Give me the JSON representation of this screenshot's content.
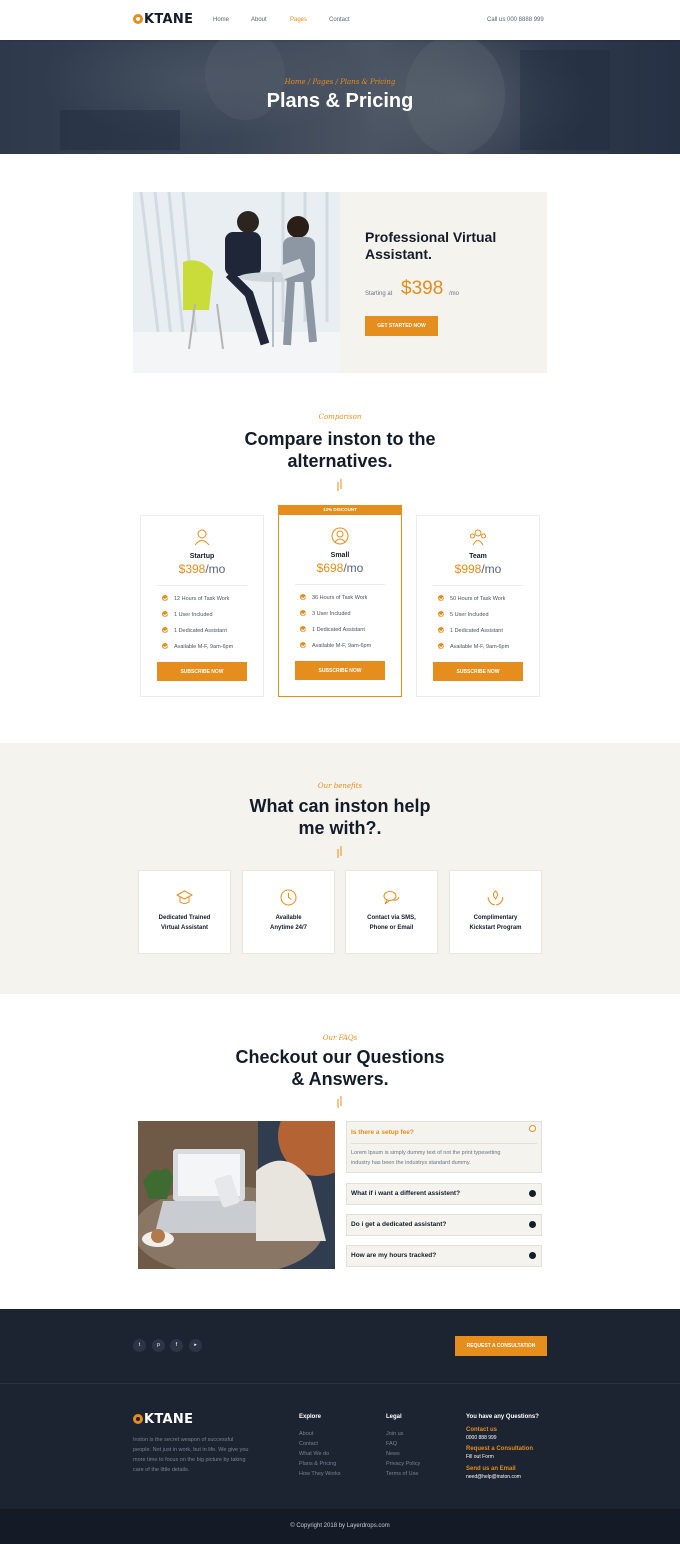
{
  "brand": {
    "logo_text": "KTANE",
    "accent": "#e58d1d",
    "dark": "#1c2432"
  },
  "header": {
    "nav": [
      "Home",
      "About",
      "Pages",
      "Contact"
    ],
    "active_nav": "Pages",
    "call": "Call us 000 8888 999"
  },
  "hero": {
    "breadcrumb": "Home / Pages / Plans & Pricing",
    "title": "Plans & Pricing"
  },
  "feature": {
    "title_line1": "Professional Virtual",
    "title_line2": "Assistant.",
    "starting": "Starting at",
    "price": "$398",
    "per": "/mo",
    "button": "Get Started Now"
  },
  "compare": {
    "script": "Comparison",
    "title_line1": "Compare inston to the",
    "title_line2": "alternatives.",
    "discount": "12% Discount",
    "plans": [
      {
        "icon": "user-icon",
        "name": "Startup",
        "price": "$398",
        "per": "/mo",
        "features": [
          "12 Hours of Task Work",
          "1 User Included",
          "1 Dedicated Assistant",
          "Available M-F, 9am-6pm"
        ],
        "button": "Subscribe Now"
      },
      {
        "icon": "user-circle-icon",
        "name": "Small",
        "price": "$698",
        "per": "/mo",
        "features": [
          "36 Hours of Task Work",
          "3 User Included",
          "1 Dedicated Assistant",
          "Available M-F, 9am-6pm"
        ],
        "button": "Subscribe Now"
      },
      {
        "icon": "team-icon",
        "name": "Team",
        "price": "$998",
        "per": "/mo",
        "features": [
          "50 Hours of Task Work",
          "5 User Included",
          "1 Dedicated Assistant",
          "Available M-F, 9am-6pm"
        ],
        "button": "Subscribe Now"
      }
    ]
  },
  "benefits": {
    "script": "Our benefits",
    "title_line1": "What can inston help",
    "title_line2": "me with?.",
    "items": [
      {
        "icon": "graduation-cap-icon",
        "line1": "Dedicated Trained",
        "line2": "Virtual Assistant"
      },
      {
        "icon": "clock-icon",
        "line1": "Available",
        "line2": "Anytime 24/7"
      },
      {
        "icon": "chat-bubbles-icon",
        "line1": "Contact via SMS,",
        "line2": "Phone or Email"
      },
      {
        "icon": "hands-leaf-icon",
        "line1": "Complimentary",
        "line2": "Kickstart Program"
      }
    ]
  },
  "faq": {
    "script": "Our FAQs",
    "title_line1": "Checkout our Questions",
    "title_line2": "& Answers.",
    "items": [
      {
        "q": "Is there a setup fee?",
        "a1": "Lorem Ipsum is simply dummy text of not the print typesetting",
        "a2": "industry has been the industrys standard dummy.",
        "open": true
      },
      {
        "q": "What if i want a different assistent?",
        "open": false
      },
      {
        "q": "Do i get a dedicated assistant?",
        "open": false
      },
      {
        "q": "How are my hours tracked?",
        "open": false
      }
    ]
  },
  "cta": {
    "socials": [
      {
        "icon": "twitter-icon",
        "glyph": "t"
      },
      {
        "icon": "pinterest-icon",
        "glyph": "p"
      },
      {
        "icon": "facebook-icon",
        "glyph": "f"
      },
      {
        "icon": "youtube-icon",
        "glyph": "▸"
      }
    ],
    "button": "Request a Consultation"
  },
  "footer": {
    "about_lines": [
      "Inston is the secret weapon of successful",
      "people. Not just in work, but in life. We give you",
      "more time to focus on the big picture by taking",
      "care of the little details."
    ],
    "explore_head": "Explore",
    "explore": [
      "About",
      "Contact",
      "What We do",
      "Plans & Pricing",
      "How They Works"
    ],
    "legal_head": "Legal",
    "legal": [
      "Join us",
      "FAQ",
      "News",
      "Privacy Policy",
      "Terms of Use"
    ],
    "questions_head": "You have any Questions?",
    "contact_label": "Contact us",
    "contact_value": "0000 888 999",
    "consult_label": "Request a Consultation",
    "consult_value": "Fill out Form",
    "email_label": "Send us an Email",
    "email_value": "need@help@inston.com",
    "copyright": "© Copyright 2018 by Layerdrops.com"
  }
}
